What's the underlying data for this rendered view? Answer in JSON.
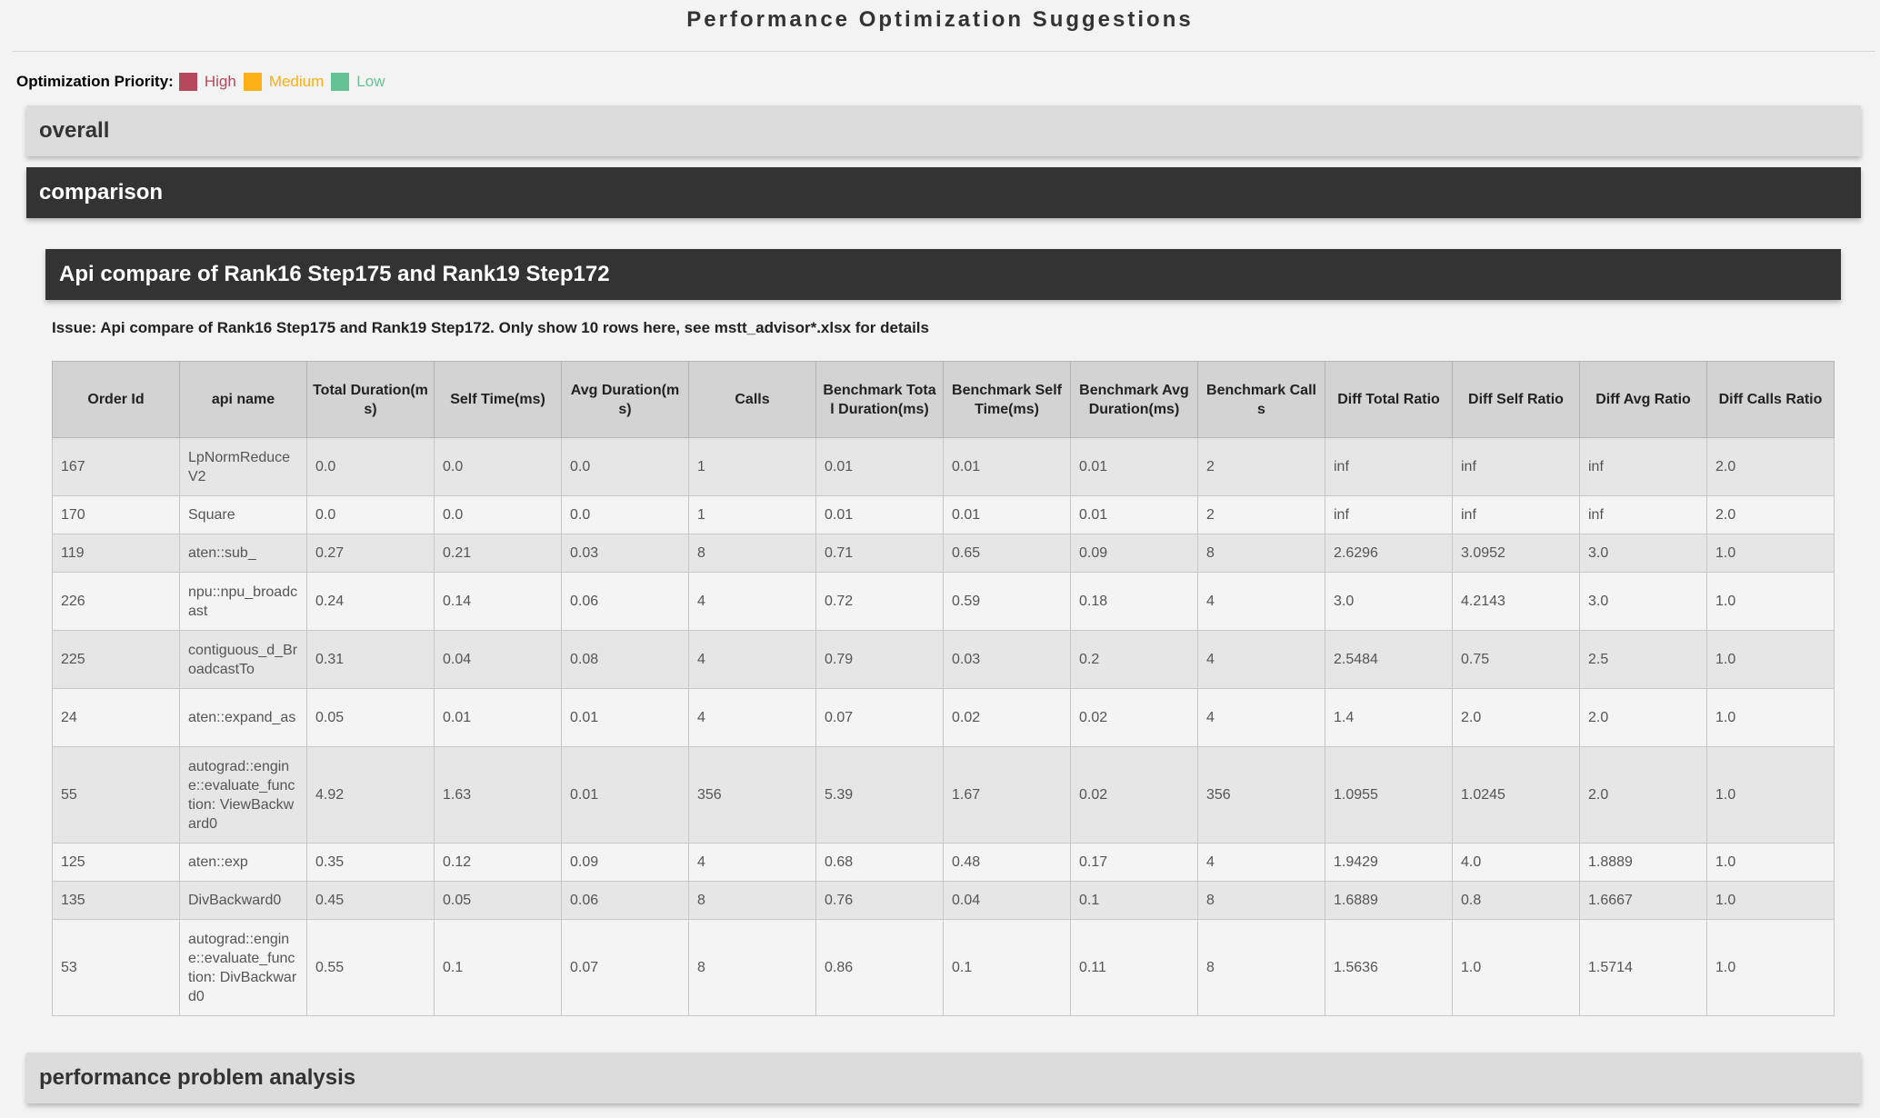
{
  "page": {
    "title": "Performance Optimization Suggestions"
  },
  "priority": {
    "label": "Optimization Priority:",
    "levels": [
      {
        "name": "High",
        "color": "#b5495b"
      },
      {
        "name": "Medium",
        "color": "#fcaf17"
      },
      {
        "name": "Low",
        "color": "#65c294"
      }
    ]
  },
  "sections": {
    "overall": "overall",
    "comparison": "comparison",
    "performance": "performance problem analysis"
  },
  "api_compare": {
    "title": "Api compare of Rank16 Step175 and Rank19 Step172",
    "issue": "Issue: Api compare of Rank16 Step175 and Rank19 Step172. Only show 10 rows here, see mstt_advisor*.xlsx for details",
    "columns": [
      "Order Id",
      "api name",
      "Total Duration(ms)",
      "Self Time(ms)",
      "Avg Duration(ms)",
      "Calls",
      "Benchmark Total Duration(ms)",
      "Benchmark Self Time(ms)",
      "Benchmark Avg Duration(ms)",
      "Benchmark Calls",
      "Diff Total Ratio",
      "Diff Self Ratio",
      "Diff Avg Ratio",
      "Diff Calls Ratio"
    ],
    "rows": [
      [
        "167",
        "LpNormReduceV2",
        "0.0",
        "0.0",
        "0.0",
        "1",
        "0.01",
        "0.01",
        "0.01",
        "2",
        "inf",
        "inf",
        "inf",
        "2.0"
      ],
      [
        "170",
        "Square",
        "0.0",
        "0.0",
        "0.0",
        "1",
        "0.01",
        "0.01",
        "0.01",
        "2",
        "inf",
        "inf",
        "inf",
        "2.0"
      ],
      [
        "119",
        "aten::sub_",
        "0.27",
        "0.21",
        "0.03",
        "8",
        "0.71",
        "0.65",
        "0.09",
        "8",
        "2.6296",
        "3.0952",
        "3.0",
        "1.0"
      ],
      [
        "226",
        "npu::npu_broadcast",
        "0.24",
        "0.14",
        "0.06",
        "4",
        "0.72",
        "0.59",
        "0.18",
        "4",
        "3.0",
        "4.2143",
        "3.0",
        "1.0"
      ],
      [
        "225",
        "contiguous_d_BroadcastTo",
        "0.31",
        "0.04",
        "0.08",
        "4",
        "0.79",
        "0.03",
        "0.2",
        "4",
        "2.5484",
        "0.75",
        "2.5",
        "1.0"
      ],
      [
        "24",
        "aten::expand_as",
        "0.05",
        "0.01",
        "0.01",
        "4",
        "0.07",
        "0.02",
        "0.02",
        "4",
        "1.4",
        "2.0",
        "2.0",
        "1.0"
      ],
      [
        "55",
        "autograd::engine::evaluate_function: ViewBackward0",
        "4.92",
        "1.63",
        "0.01",
        "356",
        "5.39",
        "1.67",
        "0.02",
        "356",
        "1.0955",
        "1.0245",
        "2.0",
        "1.0"
      ],
      [
        "125",
        "aten::exp",
        "0.35",
        "0.12",
        "0.09",
        "4",
        "0.68",
        "0.48",
        "0.17",
        "4",
        "1.9429",
        "4.0",
        "1.8889",
        "1.0"
      ],
      [
        "135",
        "DivBackward0",
        "0.45",
        "0.05",
        "0.06",
        "8",
        "0.76",
        "0.04",
        "0.1",
        "8",
        "1.6889",
        "0.8",
        "1.6667",
        "1.0"
      ],
      [
        "53",
        "autograd::engine::evaluate_function: DivBackward0",
        "0.55",
        "0.1",
        "0.07",
        "8",
        "0.86",
        "0.1",
        "0.11",
        "8",
        "1.5636",
        "1.0",
        "1.5714",
        "1.0"
      ]
    ]
  }
}
